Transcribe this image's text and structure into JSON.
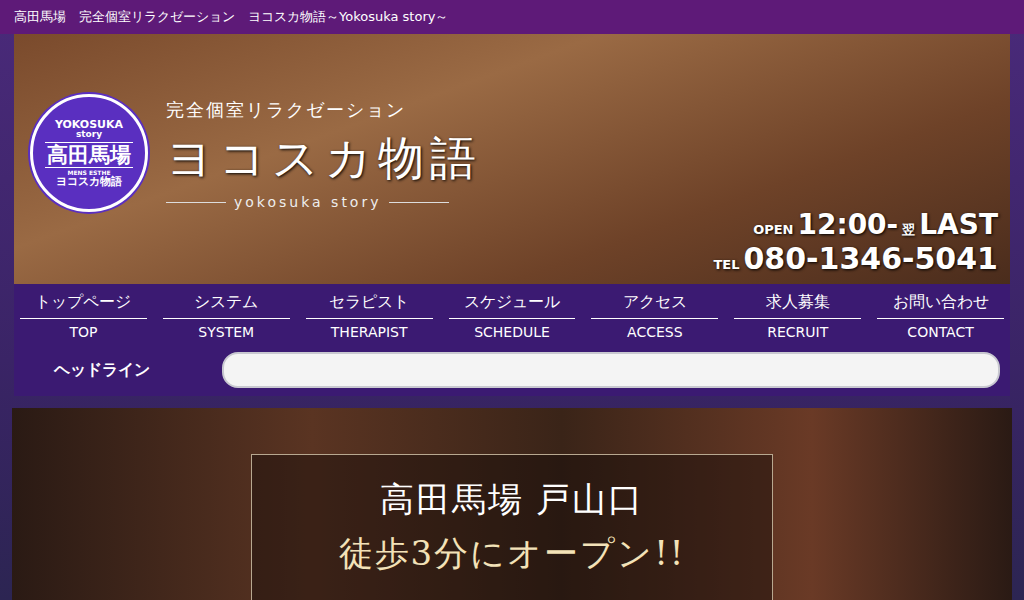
{
  "window": {
    "title": "高田馬場　完全個室リラクゼーション　ヨコスカ物語～Yokosuka story～"
  },
  "logo": {
    "top": "YOKOSUKA",
    "sub": "story",
    "main": "高田馬場",
    "small": "MENS ESTHE",
    "bottom": "ヨコスカ物語"
  },
  "brand": {
    "tagline": "完全個室リラクゼーション",
    "name": "ヨコスカ物語",
    "roman": "yokosuka story"
  },
  "hours": {
    "label": "OPEN",
    "open": "12:00-",
    "next": "翌",
    "close": "LAST"
  },
  "phone": {
    "label": "TEL",
    "number": "080-1346-5041"
  },
  "nav": [
    {
      "label": "トップページ",
      "sub": "TOP"
    },
    {
      "label": "システム",
      "sub": "SYSTEM"
    },
    {
      "label": "セラピスト",
      "sub": "THERAPIST"
    },
    {
      "label": "スケジュール",
      "sub": "SCHEDULE"
    },
    {
      "label": "アクセス",
      "sub": "ACCESS"
    },
    {
      "label": "求人募集",
      "sub": "RECRUIT"
    },
    {
      "label": "お問い合わせ",
      "sub": "CONTACT"
    }
  ],
  "headline": {
    "label": "ヘッドライン"
  },
  "banner": {
    "line1": "高田馬場 戸山口",
    "line2": "徒歩3分にオープン!!"
  }
}
